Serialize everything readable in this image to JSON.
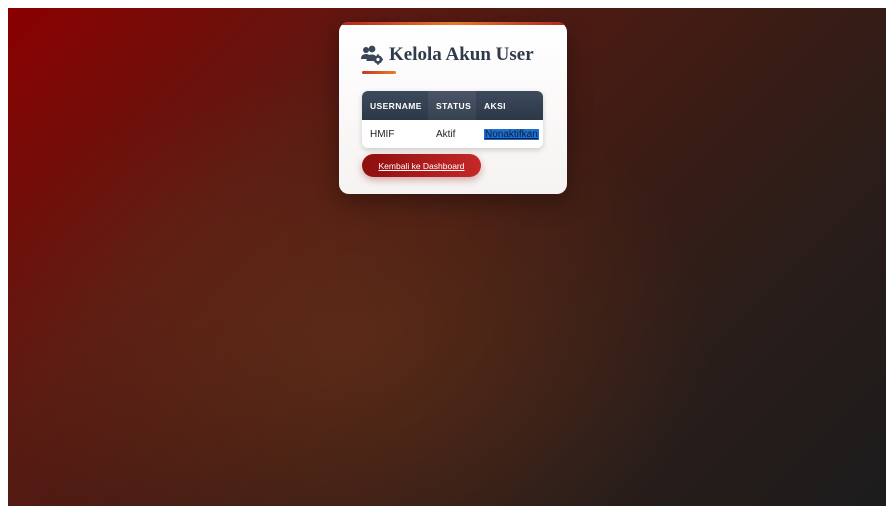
{
  "page": {
    "title": "Kelola Akun User",
    "title_icon": "users-gear-icon"
  },
  "table": {
    "headers": [
      "USERNAME",
      "STATUS",
      "AKSI"
    ],
    "rows": [
      {
        "username": "HMIF",
        "status": "Aktif",
        "action": "Nonaktifkan"
      }
    ]
  },
  "back_button": {
    "label": "Kembali ke Dashboard"
  },
  "colors": {
    "background_start": "#8b0000",
    "background_end": "#1c1c1c",
    "header_bg": "#2c3848",
    "button_bg": "#c62828",
    "accent_underline": "#e67e22",
    "link_highlight": "#1f6fd0"
  }
}
